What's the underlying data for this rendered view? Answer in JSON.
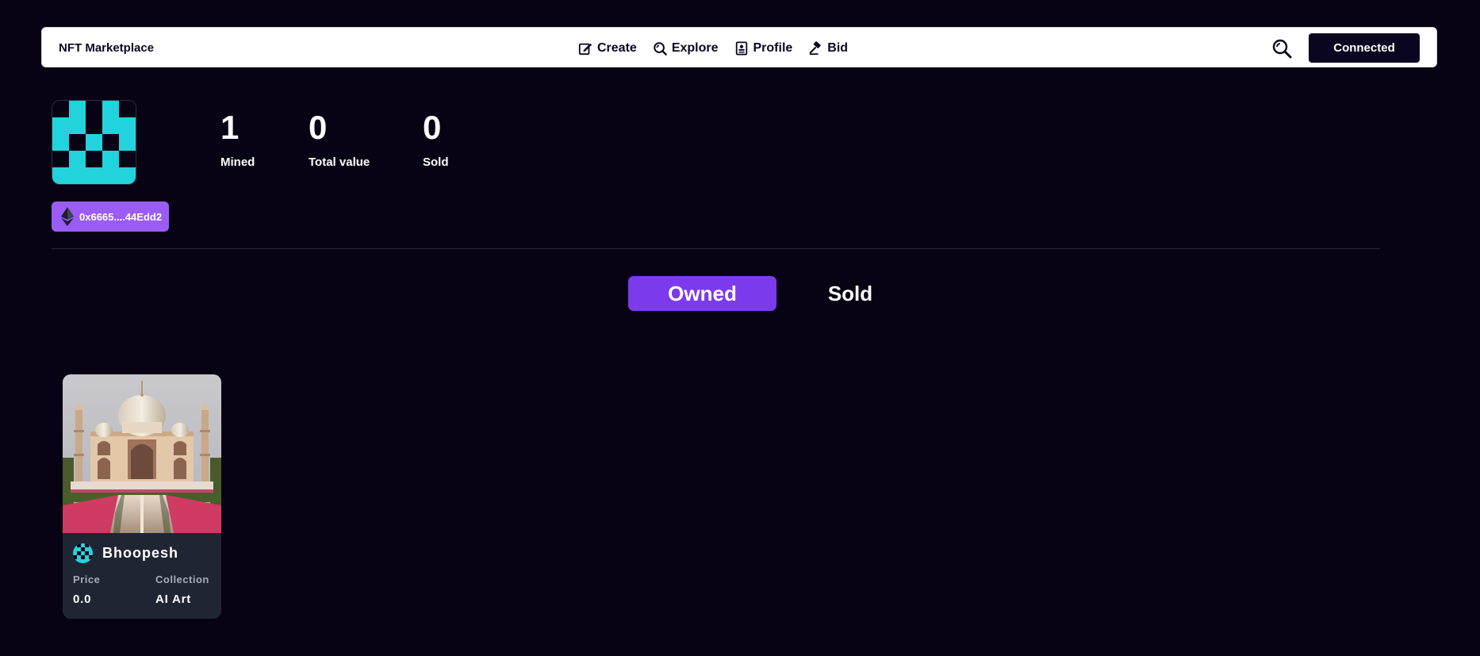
{
  "navbar": {
    "brand": "NFT Marketplace",
    "links": [
      {
        "label": "Create",
        "icon": "create-icon"
      },
      {
        "label": "Explore",
        "icon": "explore-icon"
      },
      {
        "label": "Profile",
        "icon": "profile-icon"
      },
      {
        "label": "Bid",
        "icon": "bid-icon"
      }
    ],
    "search_icon": "search-icon",
    "connect_label": "Connected"
  },
  "profile": {
    "avatar": "identicon-avatar",
    "stats": [
      {
        "value": "1",
        "label": "Mined"
      },
      {
        "value": "0",
        "label": "Total value"
      },
      {
        "value": "0",
        "label": "Sold"
      }
    ],
    "address": "0x6665....44Edd2",
    "address_icon": "ethereum-icon"
  },
  "tabs": {
    "owned": "Owned",
    "sold": "Sold",
    "active": "owned"
  },
  "nfts": [
    {
      "image": "taj-mahal-image",
      "owner": "Bhoopesh",
      "price_label": "Price",
      "price": "0.0",
      "collection_label": "Collection",
      "collection": "AI Art"
    }
  ],
  "colors": {
    "background": "#080314",
    "accent": "#7c3aed",
    "address_pill": "#9b5cf6",
    "avatar_teal": "#22d3dd",
    "card": "#1f2533"
  }
}
